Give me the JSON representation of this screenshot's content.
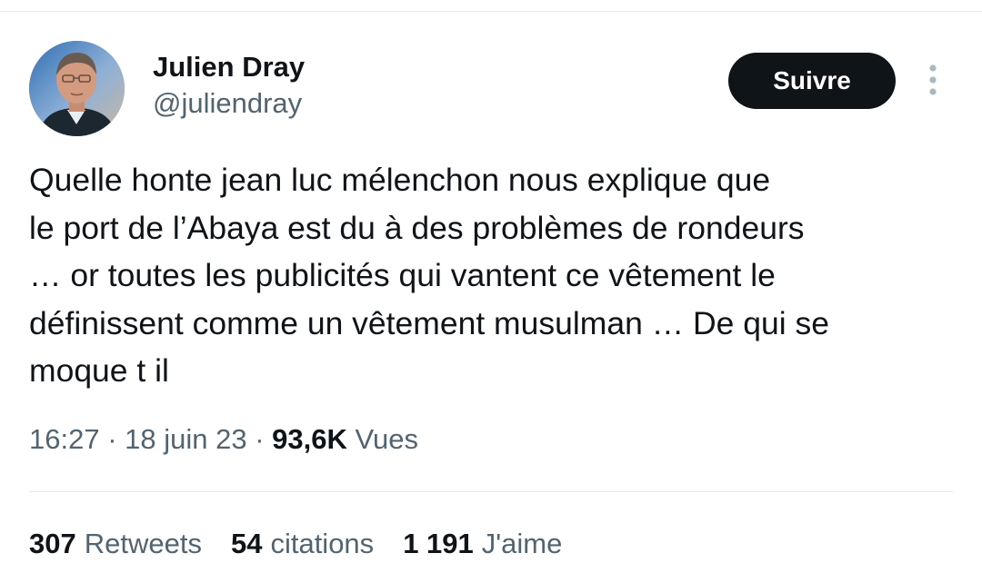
{
  "user": {
    "display_name": "Julien Dray",
    "handle": "@juliendray"
  },
  "follow_label": "Suivre",
  "more_icon": "more-vertical-icon",
  "tweet": {
    "text": "Quelle honte jean luc mélenchon nous explique que\nle port de l’Abaya est du à des problèmes de rondeurs\n… or toutes les publicités qui vantent ce vêtement le\ndéfinissent comme un vêtement musulman … De qui se\nmoque t il"
  },
  "meta": {
    "time": "16:27",
    "separator": " · ",
    "date": "18 juin 23",
    "views_count": "93,6K",
    "views_label": "Vues"
  },
  "stats": {
    "retweets_count": "307",
    "retweets_label": "Retweets",
    "quotes_count": "54",
    "quotes_label": "citations",
    "likes_count": "1 191",
    "likes_label": "J'aime"
  },
  "colors": {
    "text_primary": "#0f1419",
    "text_secondary": "#536471",
    "divider": "#e6e9ec",
    "button_bg": "#0f1419",
    "button_text": "#ffffff"
  }
}
